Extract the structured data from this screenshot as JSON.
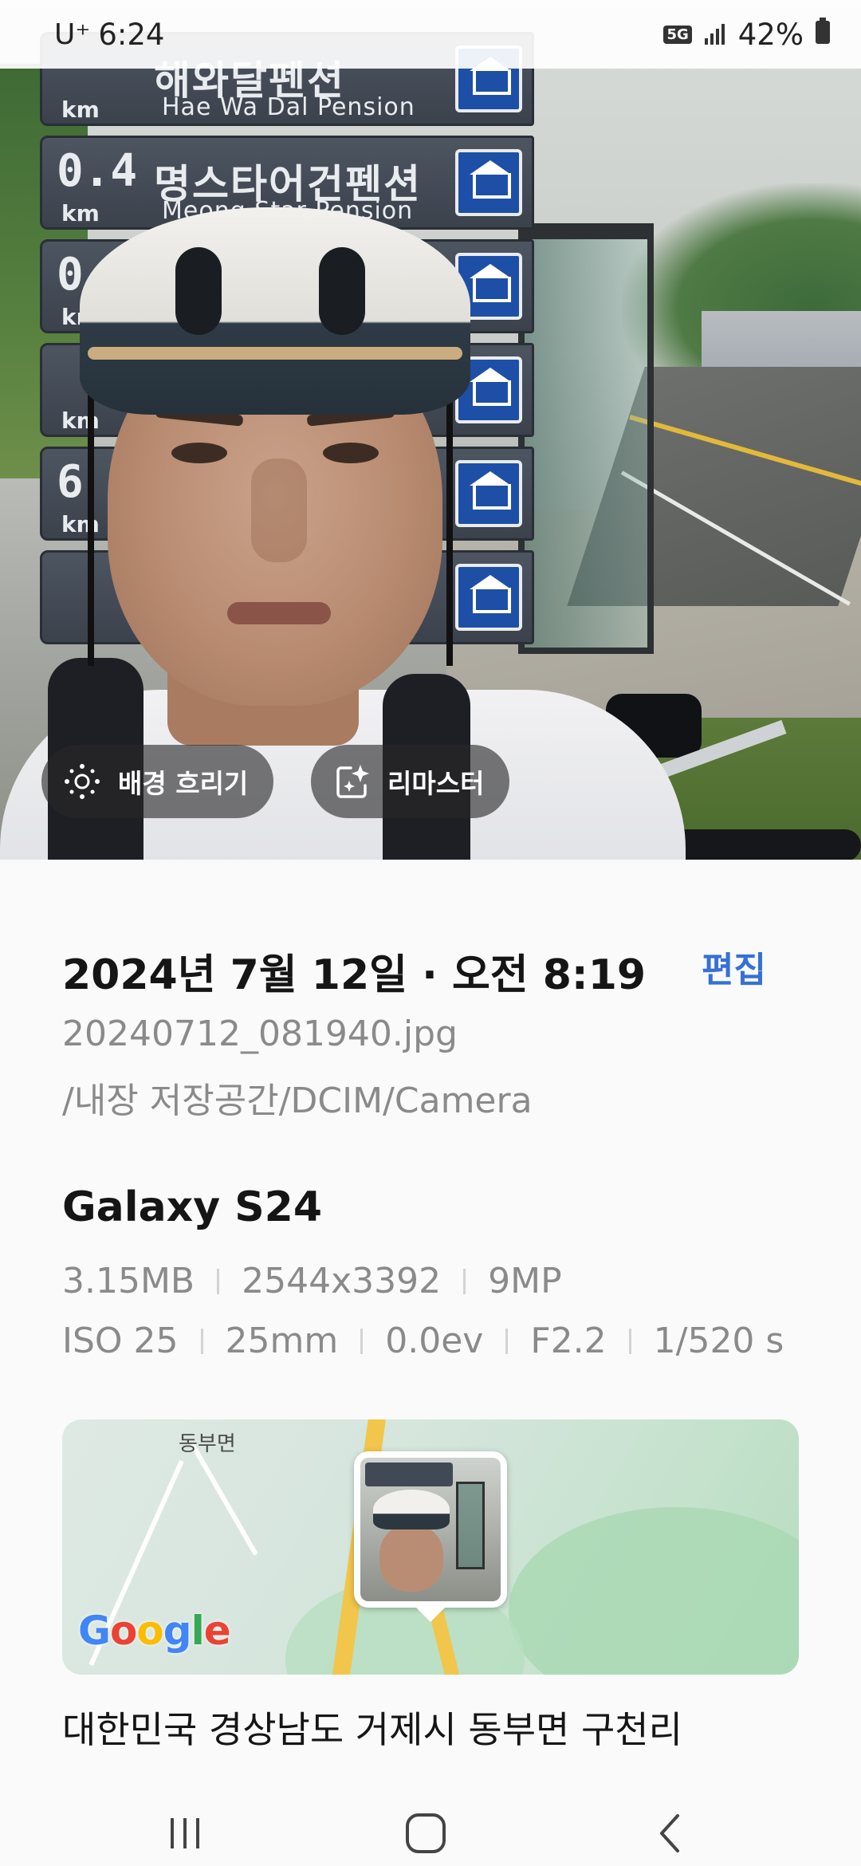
{
  "status_bar": {
    "carrier": "U⁺",
    "time": "6:24",
    "network_badge": "5G",
    "battery": "42%"
  },
  "photo": {
    "signs": [
      {
        "distance": "",
        "name": "해와달펜션",
        "subtitle": "Hae Wa Dal Pension",
        "unit": "km"
      },
      {
        "distance": "0.4",
        "name": "명스타어건펜션",
        "subtitle": "Meong Star Pension",
        "unit": "km"
      },
      {
        "distance": "0.4",
        "name": "",
        "subtitle": "",
        "unit": "km"
      },
      {
        "distance": "",
        "name": "",
        "subtitle": "",
        "unit": "km"
      },
      {
        "distance": "6",
        "name": "",
        "subtitle": "",
        "unit": "km"
      },
      {
        "distance": "",
        "name": "",
        "subtitle": "",
        "unit": ""
      }
    ],
    "chips": {
      "background_blur": "배경 흐리기",
      "remaster": "리마스터"
    }
  },
  "details": {
    "datetime": "2024년 7월 12일 · 오전 8:19",
    "edit": "편집",
    "filename": "20240712_081940.jpg",
    "path": "/내장 저장공간/DCIM/Camera",
    "device": "Galaxy S24",
    "specs_row1": [
      "3.15MB",
      "2544x3392",
      "9MP"
    ],
    "specs_row2": [
      "ISO 25",
      "25mm",
      "0.0ev",
      "F2.2",
      "1/520 s"
    ],
    "map": {
      "place_label": "동부면",
      "logo": {
        "g1": "G",
        "o1": "o",
        "o2": "o",
        "g2": "g",
        "l": "l",
        "e": "e"
      }
    },
    "address": "대한민국 경상남도 거제시 동부면 구천리"
  },
  "colors": {
    "accent": "#3571d6",
    "secondary_text": "#8a8a8a",
    "background": "#fafafa"
  },
  "nav": {
    "recents": "recents-icon",
    "home": "home-icon",
    "back": "back-icon"
  }
}
